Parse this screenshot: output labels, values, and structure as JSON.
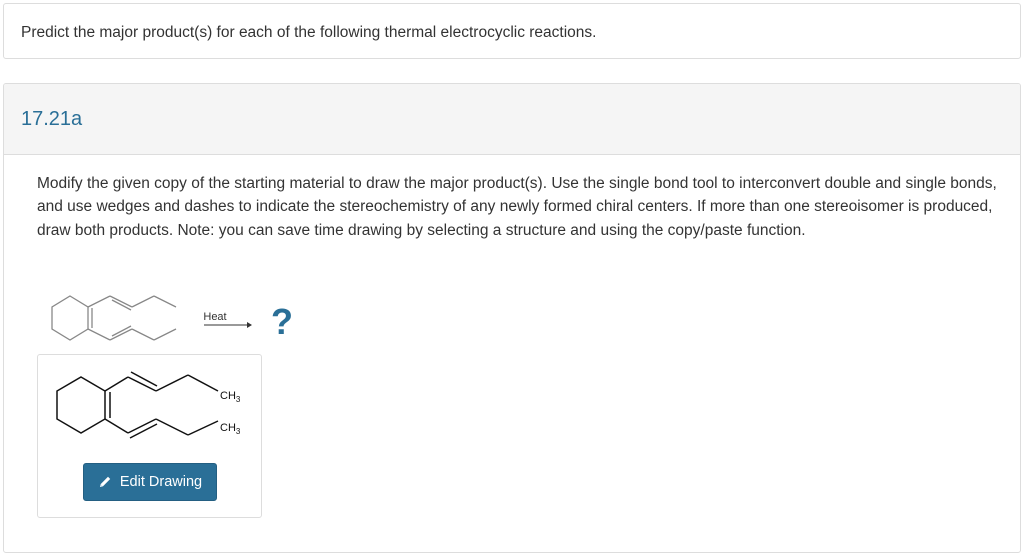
{
  "prompt": {
    "text": "Predict the major product(s) for each of the following thermal electrocyclic reactions."
  },
  "part": {
    "label": "17.21a",
    "instructions": "Modify the given copy of the starting material to draw the major product(s). Use the single bond tool to interconvert double and single bonds, and use wedges and dashes to indicate the stereochemistry of any newly formed chiral centers. If more than one stereoisomer is produced, draw both products. Note: you can save time drawing by selecting a structure and using the copy/paste function.",
    "scheme": {
      "arrow_label": "Heat",
      "unknown_product": "?"
    },
    "drawing": {
      "ch3_top": "CH",
      "ch3_top_sub": "3",
      "ch3_bottom": "CH",
      "ch3_bottom_sub": "3",
      "edit_button_label": "Edit Drawing",
      "edit_icon": "pencil-icon"
    }
  },
  "colors": {
    "accent": "#2a6f97",
    "header_bg": "#f5f5f5",
    "border": "#dddddd"
  }
}
